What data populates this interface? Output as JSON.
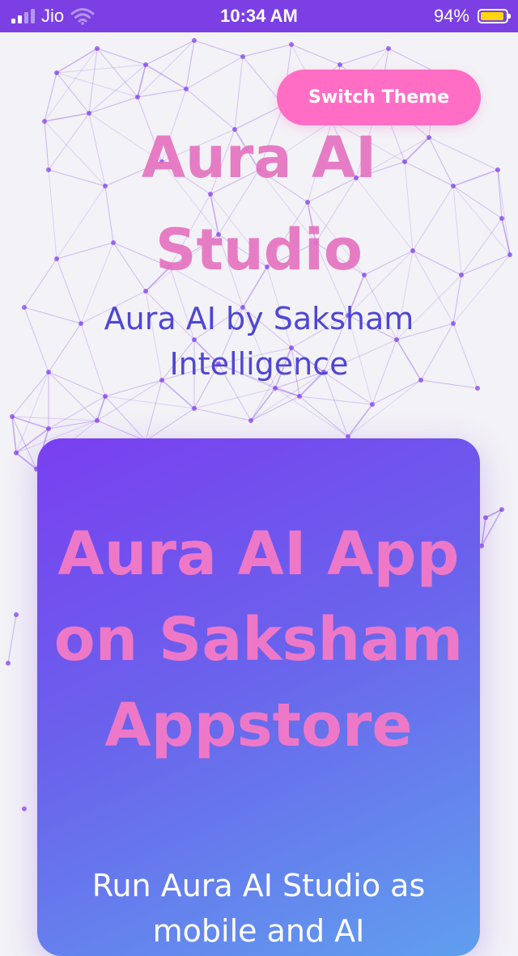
{
  "status_bar": {
    "carrier": "Jio",
    "time": "10:34 AM",
    "battery_percent": "94%",
    "battery_level": 0.94,
    "signal_bars": 2,
    "wifi": true,
    "background_color": "#7b3fe4"
  },
  "header": {
    "switch_theme_label": "Switch Theme",
    "title": "Aura AI Studio",
    "subtitle": "Aura AI by Saksham Intelligence"
  },
  "card": {
    "title": "Aura AI App on Saksham Appstore",
    "description": "Run Aura AI Studio as mobile and AI"
  },
  "colors": {
    "accent_pink": "#ff6ec4",
    "title_pink": "#e574c0",
    "subtitle_blue": "#4f46d6",
    "card_gradient_start": "#7a3ff0",
    "card_gradient_end": "#609fee",
    "network_line": "#7c3aed"
  },
  "icons": [
    "signal-icon",
    "wifi-icon",
    "battery-icon"
  ]
}
